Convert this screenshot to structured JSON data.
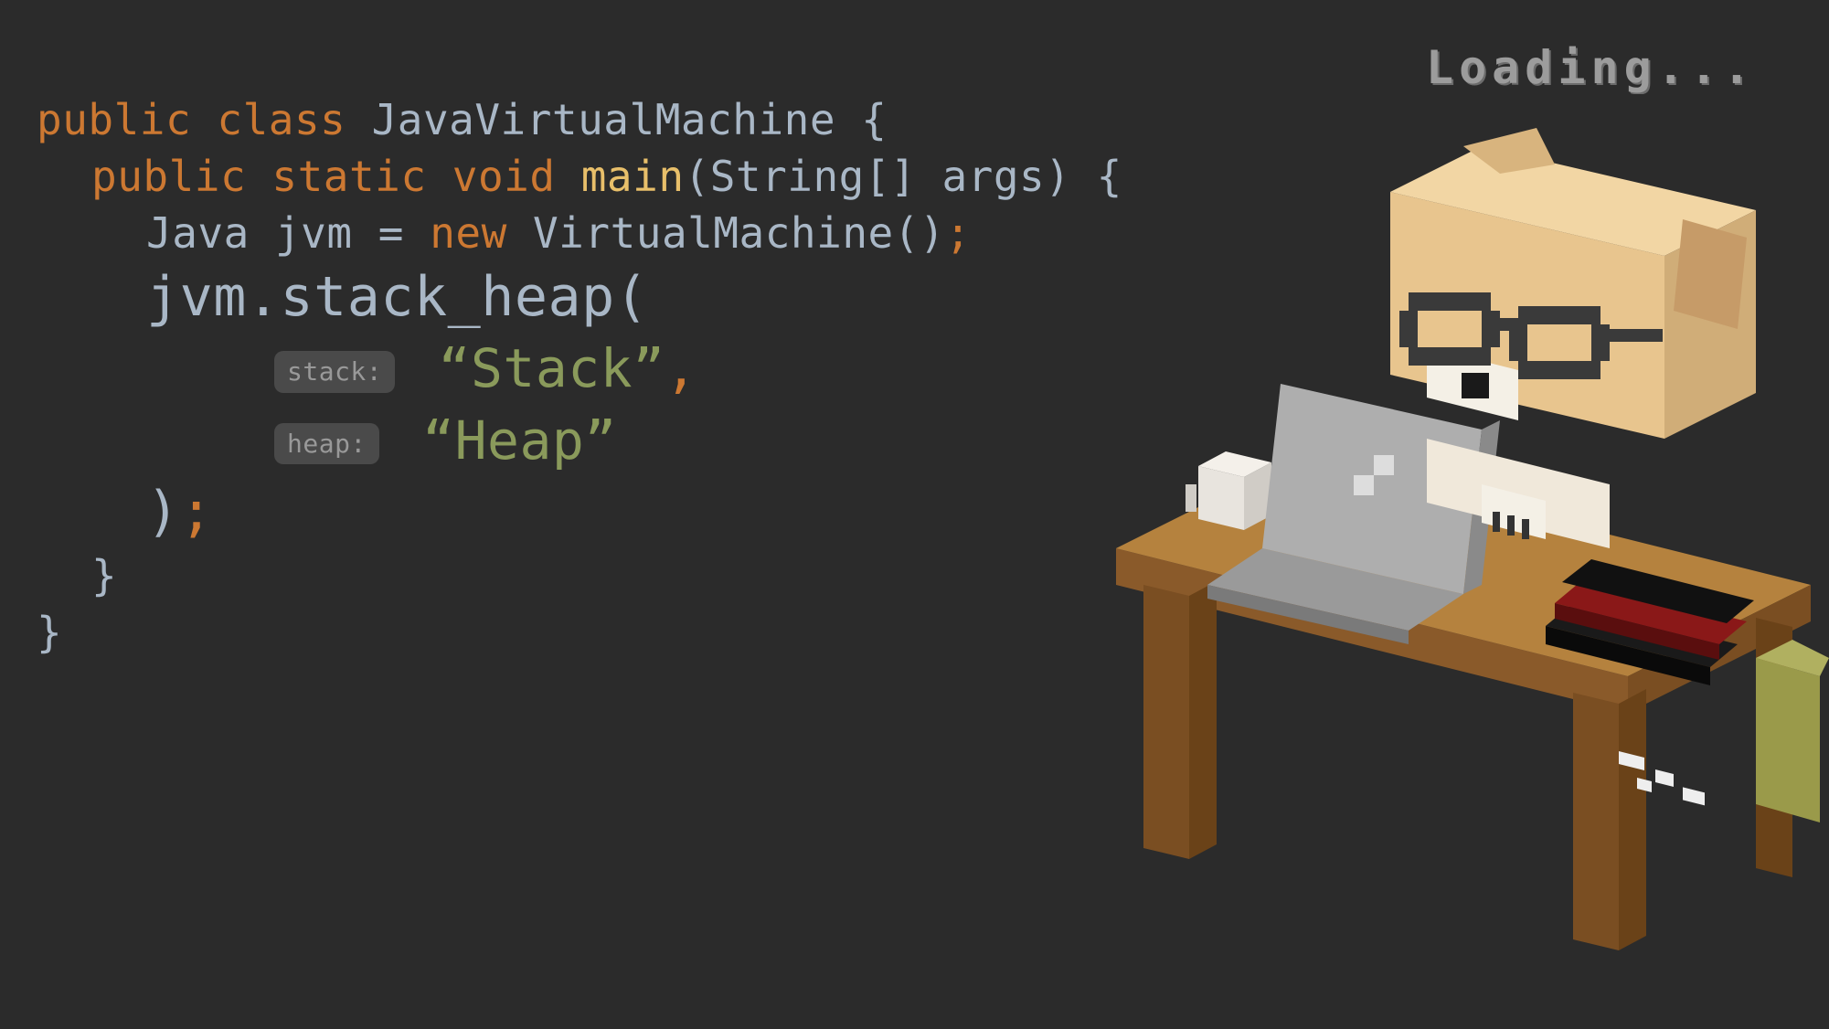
{
  "code": {
    "line1_kw1": "public",
    "line1_kw2": "class",
    "line1_name": "JavaVirtualMachine",
    "line1_brace": "{",
    "line2_kw1": "public",
    "line2_kw2": "static",
    "line2_kw3": "void",
    "line2_method": "main",
    "line2_params": "(String[] args) {",
    "line3_type": "Java",
    "line3_var": "jvm",
    "line3_eq": "=",
    "line3_new": "new",
    "line3_ctor": "VirtualMachine()",
    "line3_semi": ";",
    "line4_call": "jvm.stack_heap(",
    "line5_hint": "stack:",
    "line5_str": "“Stack”",
    "line5_comma": ",",
    "line6_hint": "heap:",
    "line6_str": "“Heap”",
    "line7_close": ")",
    "line7_semi": ";",
    "line8_brace": "}",
    "line9_brace": "}"
  },
  "illustration": {
    "loading_text": "Loading...",
    "description": "voxel-art-dog-programmer-at-desk"
  }
}
